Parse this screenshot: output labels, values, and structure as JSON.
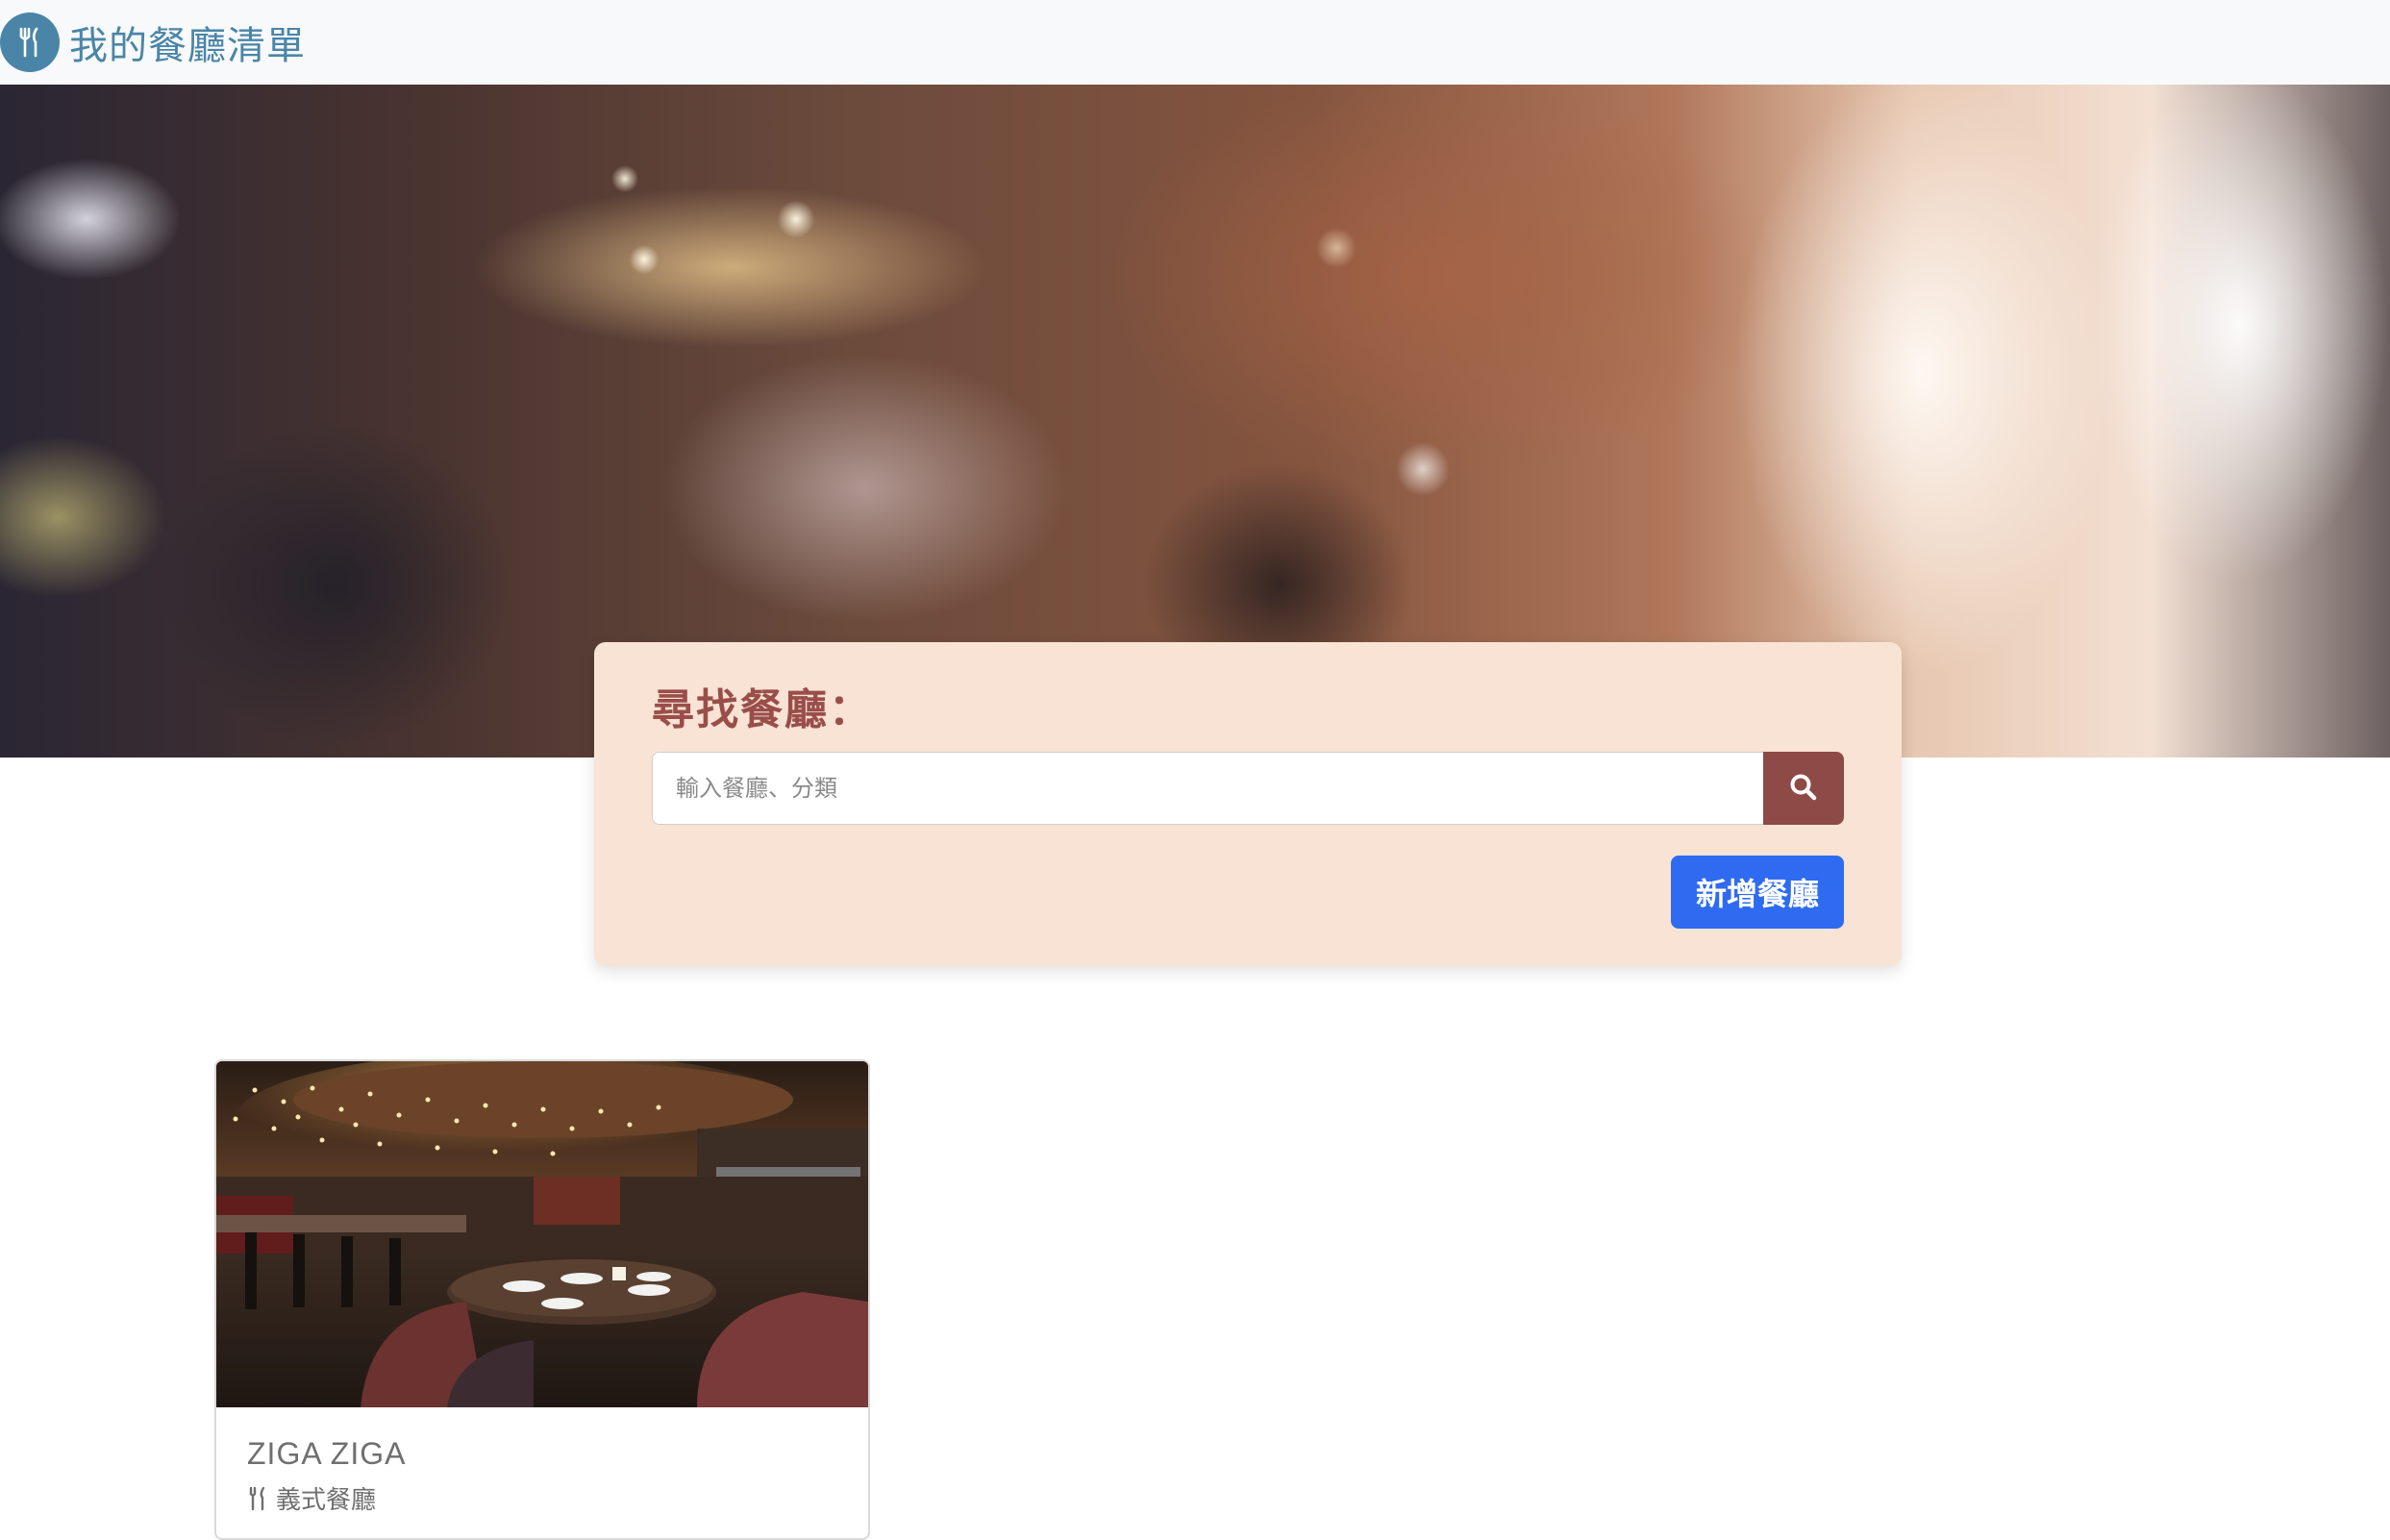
{
  "navbar": {
    "brand_title": "我的餐廳清單",
    "brand_icon": "utensils-icon",
    "brand_color": "#4a85a8"
  },
  "search": {
    "title": "尋找餐廳：",
    "placeholder": "輸入餐廳、分類",
    "value": "",
    "button_icon": "search-icon",
    "button_color": "#8e4a46",
    "card_color": "#f8e3d4"
  },
  "actions": {
    "add_label": "新增餐廳",
    "add_color": "#2f6bf0"
  },
  "restaurants": [
    {
      "name": "ZIGA ZIGA",
      "category": "義式餐廳",
      "category_icon": "utensils-icon"
    }
  ]
}
